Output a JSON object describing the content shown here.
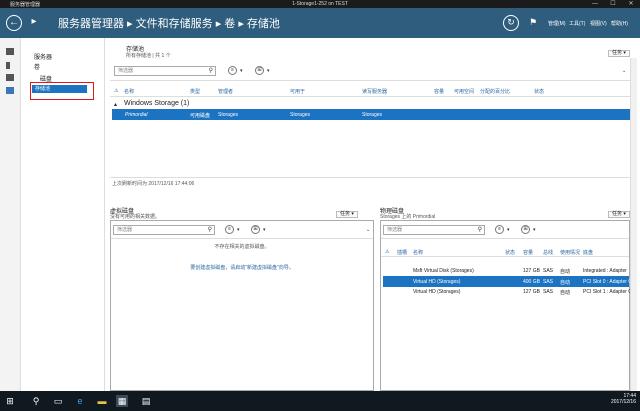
{
  "rdp": {
    "app_title": "服务器管理器",
    "window_title": "1-Storage1-252 on TEST",
    "min": "—",
    "max": "☐",
    "close": "✕"
  },
  "titlebar": {
    "back": "←",
    "forward": "▸",
    "breadcrumb": "服务器管理器 ▸ 文件和存储服务 ▸ 卷 ▸ 存储池",
    "refresh": "↻",
    "menu_manage": "管理(M)",
    "menu_tools": "工具(T)",
    "menu_view": "视图(V)",
    "menu_help": "帮助(H)"
  },
  "nav": {
    "servers": "服务器",
    "volumes": "卷",
    "disks": "磁盘",
    "storage_pools": "存储池"
  },
  "pool_panel": {
    "title": "存储池",
    "subtitle": "所有存储池 | 共 1 个",
    "tasks": "任务 ▾",
    "filter_placeholder": "筛选器",
    "columns": [
      "名称",
      "类型",
      "管理者",
      "可用于",
      "读写服务器",
      "容量",
      "可用空间",
      "分配的百分比",
      "状态"
    ],
    "group_label": "Windows Storage (1)",
    "row": {
      "name": "Primordial",
      "type": "可用磁盘",
      "managed_by": "Storages",
      "available_to": "Storages",
      "rw_server": "Storages"
    },
    "last_refresh": "上次刷新时间为 2017/12/16 17:44:06"
  },
  "vdisk_panel": {
    "title": "虚拟磁盘",
    "subtitle": "没有可用的相关数据。",
    "tasks": "任务 ▾",
    "filter_placeholder": "筛选器",
    "empty_msg": "不存在相关的虚拟磁盘。",
    "create_msg": "要创建虚拟磁盘，请启动\"新建虚拟磁盘\"向导。"
  },
  "pdisk_panel": {
    "title": "物理磁盘",
    "subtitle": "Storages 上的 Primordial",
    "tasks": "任务 ▾",
    "filter_placeholder": "筛选器",
    "columns": [
      "插槽",
      "名称",
      "状态",
      "容量",
      "总线",
      "使用情况",
      "底盘"
    ],
    "rows": [
      {
        "name": "Msft Virtual Disk (Storages)",
        "capacity": "127 GB",
        "bus": "SAS",
        "usage": "自动",
        "chassis": "Integrated : Adapter",
        "selected": false
      },
      {
        "name": "Virtual HD (Storages)",
        "capacity": "400 GB",
        "bus": "SAS",
        "usage": "自动",
        "chassis": "PCI Slot 0 : Adapter C",
        "selected": true
      },
      {
        "name": "Virtual HD (Storages)",
        "capacity": "127 GB",
        "bus": "SAS",
        "usage": "自动",
        "chassis": "PCI Slot 1 : Adapter C",
        "selected": false
      }
    ]
  },
  "taskbar": {
    "time": "17:44",
    "date": "2017/12/16"
  }
}
